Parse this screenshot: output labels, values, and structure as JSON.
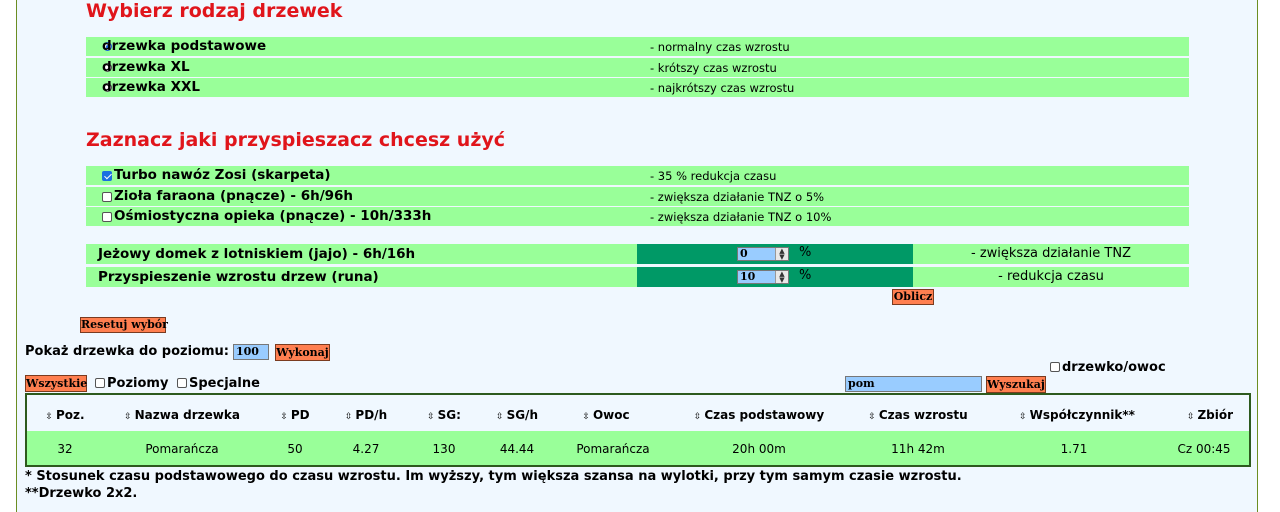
{
  "growth_type": {
    "heading": "Wybierz rodzaj drzewek",
    "options": [
      {
        "label": "drzewka podstawowe",
        "desc": "- normalny czas wzrostu",
        "selected": true
      },
      {
        "label": "drzewka XL",
        "desc": "- krótszy czas wzrostu",
        "selected": false
      },
      {
        "label": "drzewka XXL",
        "desc": "- najkrótszy czas wzrostu",
        "selected": false
      }
    ]
  },
  "accelerator": {
    "heading": "Zaznacz jaki przyspieszacz chcesz użyć",
    "options": [
      {
        "label": "Turbo nawóz Zosi (skarpeta)",
        "desc": "- 35 % redukcja czasu",
        "checked": true
      },
      {
        "label": "Zioła faraona (pnącze) - 6h/96h",
        "desc": "- zwiększa działanie TNZ o 5%",
        "checked": false
      },
      {
        "label": "Ośmiostyczna opieka (pnącze) - 10h/333h",
        "desc": "- zwiększa działanie TNZ o 10%",
        "checked": false
      }
    ],
    "percent_rows": [
      {
        "label": "Jeżowy domek z lotniskiem (jajo) - 6h/16h",
        "value": "0",
        "unit": "%",
        "desc": "- zwiększa działanie TNZ"
      },
      {
        "label": "Przyspieszenie wzrostu drzew (runa)",
        "value": "10",
        "unit": "%",
        "desc": "- redukcja czasu"
      }
    ],
    "calculate_label": "Oblicz",
    "reset_label": "Resetuj wybór"
  },
  "level_filter": {
    "label": "Pokaż drzewka do poziomu:",
    "value": "100",
    "execute_label": "Wykonaj"
  },
  "filters": {
    "all_label": "Wszystkie",
    "level_label": "Poziomy",
    "special_label": "Specjalne",
    "tree_fruit_label": "drzewko/owoc",
    "search_value": "pom",
    "search_label": "Wyszukaj"
  },
  "table": {
    "sort_glyph": "⇳",
    "columns": [
      "Poz.",
      "Nazwa drzewka",
      "PD",
      "PD/h",
      "SG:",
      "SG/h",
      "Owoc",
      "Czas podstawowy",
      "Czas wzrostu",
      "Współczynnik**",
      "Zbiór"
    ],
    "rows": [
      [
        "32",
        "Pomarańcza",
        "50",
        "4.27",
        "130",
        "44.44",
        "Pomarańcza",
        "20h 00m",
        "11h 42m",
        "1.71",
        "Cz 00:45"
      ]
    ]
  },
  "footnotes": [
    "* Stosunek czasu podstawowego do czasu wzrostu. Im wyższy, tym większa szansa na wylotki, przy tym samym czasie wzrostu.",
    "**Drzewko 2x2."
  ],
  "colors": {
    "heading": "#e0151b",
    "row_green": "#99ff99",
    "dark_green": "#009966",
    "button": "#ff7f50",
    "input_blue": "#99ccff"
  }
}
